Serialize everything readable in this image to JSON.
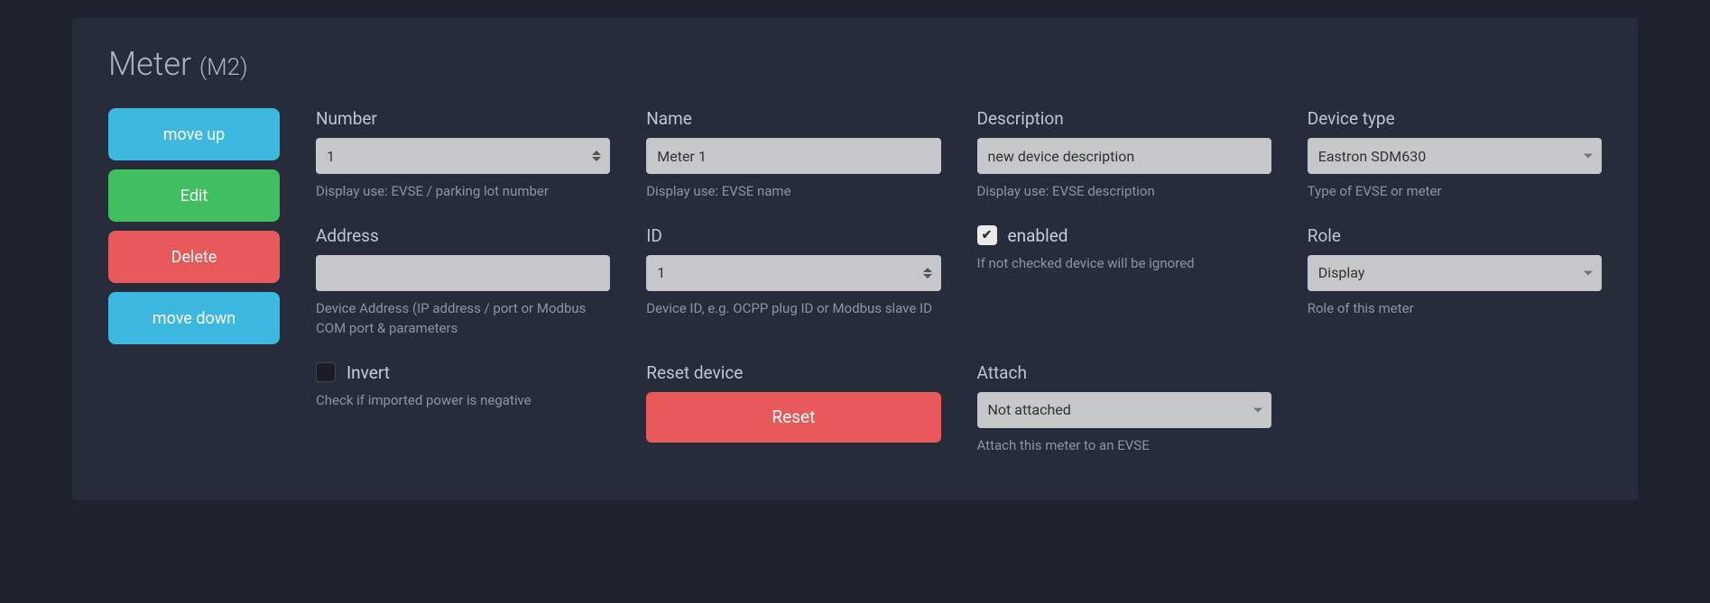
{
  "title": {
    "main": "Meter",
    "sub": "(M2)"
  },
  "sidebar": {
    "move_up": "move up",
    "edit": "Edit",
    "delete": "Delete",
    "move_down": "move down"
  },
  "fields": {
    "number": {
      "label": "Number",
      "value": "1",
      "help": "Display use: EVSE / parking lot number"
    },
    "name": {
      "label": "Name",
      "value": "Meter 1",
      "help": "Display use: EVSE name"
    },
    "description": {
      "label": "Description",
      "value": "new device description",
      "help": "Display use: EVSE description"
    },
    "device_type": {
      "label": "Device type",
      "value": "Eastron SDM630",
      "help": "Type of EVSE or meter"
    },
    "address": {
      "label": "Address",
      "value": "",
      "help": "Device Address (IP address / port or Modbus COM port & parameters"
    },
    "id": {
      "label": "ID",
      "value": "1",
      "help": "Device ID, e.g. OCPP plug ID or Modbus slave ID"
    },
    "enabled": {
      "label": "enabled",
      "checked": true,
      "help": "If not checked device will be ignored"
    },
    "role": {
      "label": "Role",
      "value": "Display",
      "help": "Role of this meter"
    },
    "invert": {
      "label": "Invert",
      "checked": false,
      "help": "Check if imported power is negative"
    },
    "reset": {
      "label": "Reset device",
      "button": "Reset"
    },
    "attach": {
      "label": "Attach",
      "value": "Not attached",
      "help": "Attach this meter to an EVSE"
    }
  }
}
